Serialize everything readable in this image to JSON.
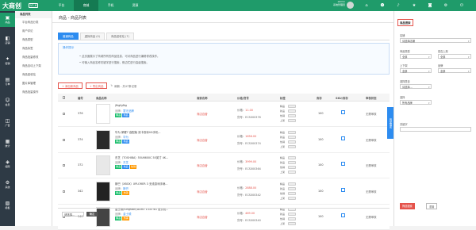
{
  "app": {
    "logo": "大商创",
    "badge": "V1.6",
    "nav": [
      "平台",
      "商城",
      "手机",
      "资源"
    ],
    "active_nav": 1,
    "user_name": "admin",
    "user_sub": "系统管理员"
  },
  "leftnav": [
    {
      "label": "商品",
      "icon": "▣"
    },
    {
      "label": "店铺",
      "icon": "◧"
    },
    {
      "label": "促销",
      "icon": "✦"
    },
    {
      "label": "订单",
      "icon": "▤"
    },
    {
      "label": "会员",
      "icon": "☺"
    },
    {
      "label": "广告",
      "icon": "◫"
    },
    {
      "label": "统计",
      "icon": "▦"
    },
    {
      "label": "权限",
      "icon": "◈"
    },
    {
      "label": "系统",
      "icon": "⚙"
    },
    {
      "label": "模板",
      "icon": "▧"
    }
  ],
  "subnav": {
    "title": "商品列表",
    "items": [
      "平台商品分类",
      "用户评论",
      "商品类型",
      "商品标签",
      "商品批量修改",
      "商品自动上下架",
      "商品回收站",
      "图片库管理",
      "商品批量操作"
    ]
  },
  "page": {
    "title": "商品 - 商品列表",
    "tabs": [
      {
        "label": "普通商品"
      },
      {
        "label": "虚拟商品 (0)"
      },
      {
        "label": "商品回收站 (7)"
      }
    ],
    "tip_title": "操作提示",
    "tip_lines": [
      "• 此页面展示了商城所有的商品信息，可对商品进行编辑修改操作。",
      "• 可输入商品名称关键字进行搜索，侧边栏进行高级搜索。"
    ],
    "btn_add": "+ 添加新商品",
    "btn_export": "+ 导出商品",
    "refresh": "刷新 - 共47条记录"
  },
  "table": {
    "headers": [
      "编号",
      "商品名称",
      "商家名称",
      "价格/货号",
      "标签",
      "库存",
      "SKU/库存",
      "审核状态"
    ],
    "rows": [
      {
        "id": "376",
        "name": "jfkgfgfkg",
        "brand": "品牌：",
        "brand_val": "暂无品牌",
        "tags": [
          {
            "t": "精品",
            "c": "#19be6b"
          },
          {
            "t": "新品",
            "c": "#2d8cf0"
          }
        ],
        "status": "商店自营",
        "price_label": "价格：",
        "price": "11.00",
        "sku_label": "货号：",
        "sku": "ECS000376",
        "stock": "100",
        "sale": "无需审核"
      },
      {
        "id": "374",
        "name": "华为 荣耀7 高配版 双卡双待4G手机...",
        "brand": "品牌：",
        "brand_val": "华为",
        "tags": [
          {
            "t": "精品",
            "c": "#19be6b"
          },
          {
            "t": "新品",
            "c": "#2d8cf0"
          }
        ],
        "status": "商店自营",
        "price_label": "价格：",
        "price": "1656.00",
        "sku_label": "货号：",
        "sku": "ECS000374",
        "stock": "100",
        "sale": "无需审核"
      },
      {
        "id": "372",
        "name": "东芝（TOSHIBA）55U6600C 55英寸 4K...",
        "brand": "品牌：",
        "brand_val": "东芝",
        "tags": [
          {
            "t": "精品",
            "c": "#19be6b"
          },
          {
            "t": "新品",
            "c": "#2d8cf0"
          },
          {
            "t": "热销",
            "c": "#ff9900"
          }
        ],
        "status": "商店自营",
        "price_label": "价格：",
        "price": "3999.00",
        "sku_label": "货号：",
        "sku": "ECS000364",
        "stock": "100",
        "sale": "无需审核"
      },
      {
        "id": "342",
        "name": "斯巴（XBOX）XPLORER 3 无线游戏手柄...",
        "brand": "品牌：",
        "brand_val": "斯巴",
        "tags": [
          {
            "t": "精品",
            "c": "#19be6b"
          },
          {
            "t": "热销",
            "c": "#ff9900"
          }
        ],
        "status": "商店自营",
        "price_label": "价格：",
        "price": "2888.00",
        "sku_label": "货号：",
        "sku": "ECS000342",
        "stock": "100",
        "sale": "无需审核"
      },
      {
        "id": "340",
        "name": "金士顿(Kingston)DDR3 1333 4G 台式机...",
        "brand": "品牌：",
        "brand_val": "金士顿",
        "tags": [
          {
            "t": "精品",
            "c": "#19be6b"
          },
          {
            "t": "热销",
            "c": "#ff9900"
          }
        ],
        "status": "商店自营",
        "price_label": "价格：",
        "price": "469.00",
        "sku_label": "货号：",
        "sku": "ECS000340",
        "stock": "100",
        "sale": "无需审核"
      }
    ],
    "toggle_labels": [
      "精品",
      "新品",
      "热销",
      "上架"
    ]
  },
  "pager": {
    "select": "请选择...",
    "button": "确定"
  },
  "sidetab": "商品搜索",
  "filter": {
    "title": "商品搜索",
    "fields": [
      {
        "label": "店铺",
        "value": "请选择店铺"
      },
      {
        "label": "商品类型",
        "value": "全部"
      },
      {
        "label": "是否上架",
        "value": "全部"
      },
      {
        "label": "上下架",
        "value": "全部"
      },
      {
        "label": "品牌",
        "value": "全部"
      },
      {
        "label": "选择类目",
        "value": "请选择..."
      },
      {
        "label": "选择",
        "value": "所有品牌"
      }
    ],
    "keyword_label": "关键字",
    "search": "筛选搜索",
    "reset": "重置"
  }
}
